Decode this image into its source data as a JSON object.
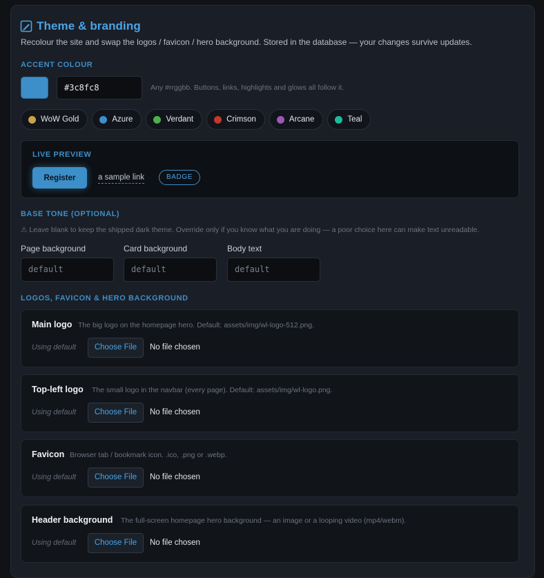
{
  "header": {
    "title": "Theme & branding",
    "subtitle": "Recolour the site and swap the logos / favicon / hero background. Stored in the database — your changes survive updates."
  },
  "accent": {
    "section_label": "ACCENT COLOUR",
    "value": "#3c8fc8",
    "hint": "Any #rrggbb. Buttons, links, highlights and glows all follow it.",
    "presets": [
      {
        "label": "WoW Gold",
        "color": "#c9a24a"
      },
      {
        "label": "Azure",
        "color": "#3c8fc8"
      },
      {
        "label": "Verdant",
        "color": "#4caf50"
      },
      {
        "label": "Crimson",
        "color": "#c0392b"
      },
      {
        "label": "Arcane",
        "color": "#9b59b6"
      },
      {
        "label": "Teal",
        "color": "#1abc9c"
      }
    ]
  },
  "preview": {
    "label": "LIVE PREVIEW",
    "button": "Register",
    "link": "a sample link",
    "badge": "BADGE"
  },
  "base_tone": {
    "section_label": "BASE TONE (OPTIONAL)",
    "warning": "⚠ Leave blank to keep the shipped dark theme. Override only if you know what you are doing — a poor choice here can make text unreadable.",
    "fields": [
      {
        "label": "Page background",
        "placeholder": "default"
      },
      {
        "label": "Card background",
        "placeholder": "default"
      },
      {
        "label": "Body text",
        "placeholder": "default"
      }
    ]
  },
  "assets": {
    "section_label": "LOGOS, FAVICON & HERO BACKGROUND",
    "items": [
      {
        "title": "Main logo",
        "desc": "The big logo on the homepage hero. Default: assets/img/wl-logo-512.png.",
        "status": "Using default",
        "button": "Choose File",
        "file": "No file chosen"
      },
      {
        "title": "Top-left logo",
        "desc": "The small logo in the navbar (every page). Default: assets/img/wl-logo.png.",
        "status": "Using default",
        "button": "Choose File",
        "file": "No file chosen"
      },
      {
        "title": "Favicon",
        "desc": "Browser tab / bookmark icon. .ico, .png or .webp.",
        "status": "Using default",
        "button": "Choose File",
        "file": "No file chosen"
      },
      {
        "title": "Header background",
        "desc": "The full-screen homepage hero background — an image or a looping video (mp4/webm).",
        "status": "Using default",
        "button": "Choose File",
        "file": "No file chosen"
      }
    ]
  },
  "colors": {
    "accent": "#3c8fc8",
    "panel": "#1a1e26",
    "page": "#101216"
  }
}
